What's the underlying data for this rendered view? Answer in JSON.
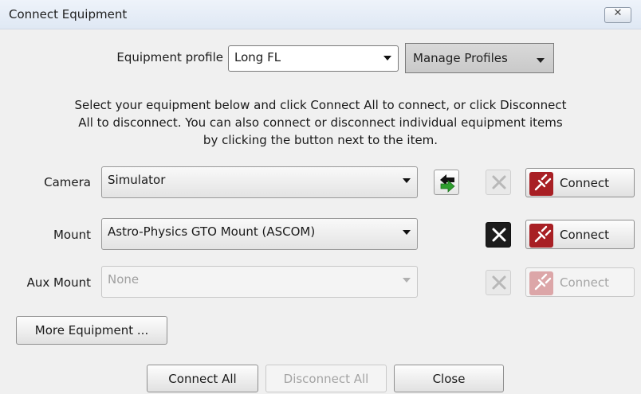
{
  "window": {
    "title": "Connect Equipment",
    "close_glyph": "✕"
  },
  "profile": {
    "label": "Equipment profile",
    "value": "Long FL",
    "manage_label": "Manage Profiles"
  },
  "instructions": {
    "line1": "Select your equipment below and click Connect All to connect, or click Disconnect",
    "line2": "All to disconnect. You can also connect or disconnect individual equipment items",
    "line3": "by clicking the button next to the item."
  },
  "equipment": [
    {
      "label": "Camera",
      "value": "Simulator",
      "connect_label": "Connect",
      "enabled": true
    },
    {
      "label": "Mount",
      "value": "Astro-Physics GTO Mount (ASCOM)",
      "connect_label": "Connect",
      "enabled": true
    },
    {
      "label": "Aux Mount",
      "value": "None",
      "connect_label": "Connect",
      "enabled": false
    }
  ],
  "more_equipment_label": "More Equipment ...",
  "footer": {
    "connect_all": "Connect All",
    "disconnect_all": "Disconnect All",
    "close": "Close"
  },
  "icons": {
    "swap": "swap-arrows-icon",
    "setup": "setup-tools-icon",
    "connect": "plug-connect-icon"
  },
  "colors": {
    "connect_red": "#a81f24",
    "swap_green": "#2e9e2e",
    "setup_dark": "#1c1c1c"
  }
}
